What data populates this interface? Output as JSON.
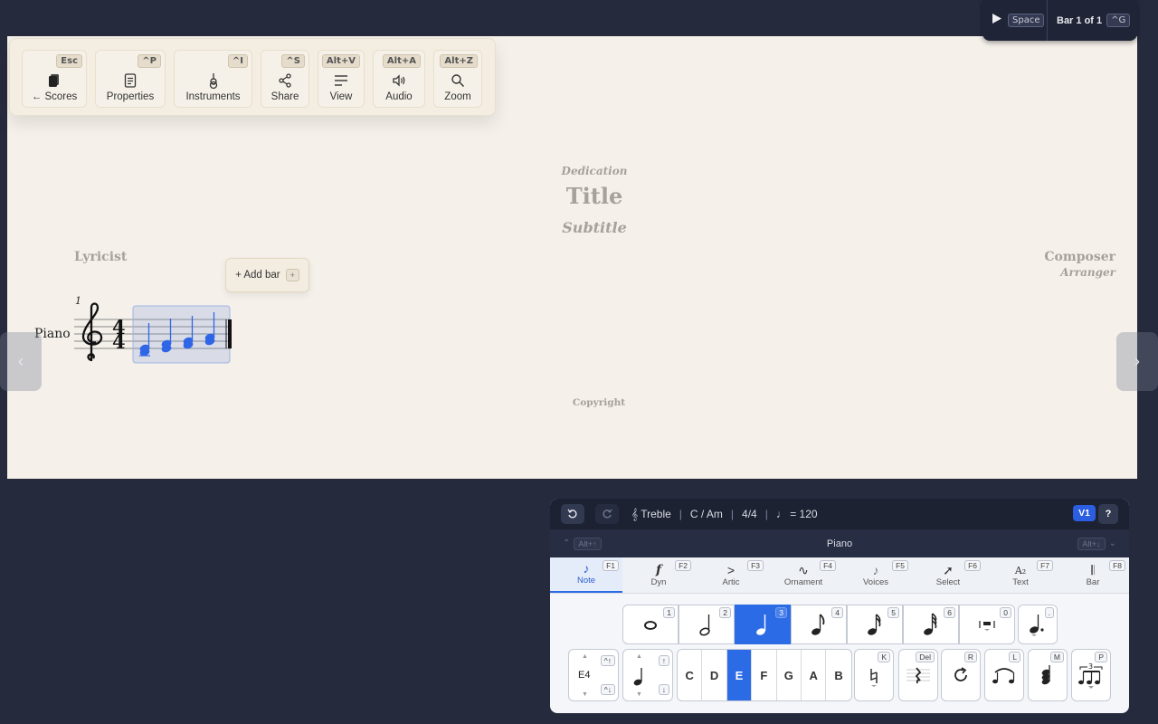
{
  "toolbar": {
    "buttons": [
      {
        "label": "← Scores",
        "key": "Esc",
        "icon": "book-icon"
      },
      {
        "label": "Properties",
        "key": "^P",
        "icon": "document-icon"
      },
      {
        "label": "Instruments",
        "key": "^I",
        "icon": "guitar-icon"
      },
      {
        "label": "Share",
        "key": "^S",
        "icon": "share-icon"
      },
      {
        "label": "View",
        "key": "Alt+V",
        "icon": "lines-icon"
      },
      {
        "label": "Audio",
        "key": "Alt+A",
        "icon": "speaker-icon"
      },
      {
        "label": "Zoom",
        "key": "Alt+Z",
        "icon": "magnifier-icon"
      }
    ]
  },
  "playback": {
    "play_key": "Space",
    "bar_label": "Bar 1 of 1",
    "goto_key": "^G"
  },
  "score": {
    "dedication": "Dedication",
    "title": "Title",
    "subtitle": "Subtitle",
    "lyricist": "Lyricist",
    "composer": "Composer",
    "arranger": "Arranger",
    "copyright": "Copyright",
    "instrument": "Piano",
    "bar_number": "1",
    "time_sig_top": "4",
    "time_sig_bottom": "4",
    "add_bar_label": "+ Add bar",
    "add_bar_key": "+",
    "note_color": "#2f66e8"
  },
  "palette": {
    "info": {
      "clef": "𝄞 Treble",
      "key": "C / Am",
      "time": "4/4",
      "tempo": "♩ = 120"
    },
    "voice": "V1",
    "help": "?",
    "instrument": "Piano",
    "prev_key": "Alt+↑",
    "next_key": "Alt+↓",
    "tabs": [
      {
        "label": "Note",
        "key": "F1",
        "icon": "♪"
      },
      {
        "label": "Dyn",
        "key": "F2",
        "icon": "f"
      },
      {
        "label": "Artic",
        "key": "F3",
        "icon": ">"
      },
      {
        "label": "Ornament",
        "key": "F4",
        "icon": "∿"
      },
      {
        "label": "Voices",
        "key": "F5",
        "icon": "♪"
      },
      {
        "label": "Select",
        "key": "F6",
        "icon": "➚"
      },
      {
        "label": "Text",
        "key": "F7",
        "icon": "A₂"
      },
      {
        "label": "Bar",
        "key": "F8",
        "icon": "𝄃"
      }
    ],
    "durations": [
      {
        "key": "1",
        "icon": "whole-note-icon"
      },
      {
        "key": "2",
        "icon": "half-note-icon"
      },
      {
        "key": "3",
        "icon": "quarter-note-icon"
      },
      {
        "key": "4",
        "icon": "eighth-note-icon"
      },
      {
        "key": "5",
        "icon": "sixteenth-note-icon"
      },
      {
        "key": "6",
        "icon": "thirty-second-note-icon"
      },
      {
        "key": "0",
        "icon": "measure-rest-icon"
      }
    ],
    "dot_key": ".",
    "octave": {
      "value": "E4",
      "up_key": "^↑",
      "down_key": "^↓"
    },
    "note_value_keys": {
      "up": "↑",
      "down": "↓"
    },
    "pitches": [
      "C",
      "D",
      "E",
      "F",
      "G",
      "A",
      "B"
    ],
    "active_pitch": "E",
    "tools": [
      {
        "key": "K",
        "icon": "natural-icon"
      },
      {
        "key": "Del",
        "icon": "rest-icon"
      },
      {
        "key": "R",
        "icon": "repeat-icon"
      },
      {
        "key": "L",
        "icon": "tie-icon"
      },
      {
        "key": "M",
        "icon": "chord-icon"
      },
      {
        "key": "P",
        "icon": "tuplet-icon"
      }
    ],
    "tuplet_number": "3"
  }
}
